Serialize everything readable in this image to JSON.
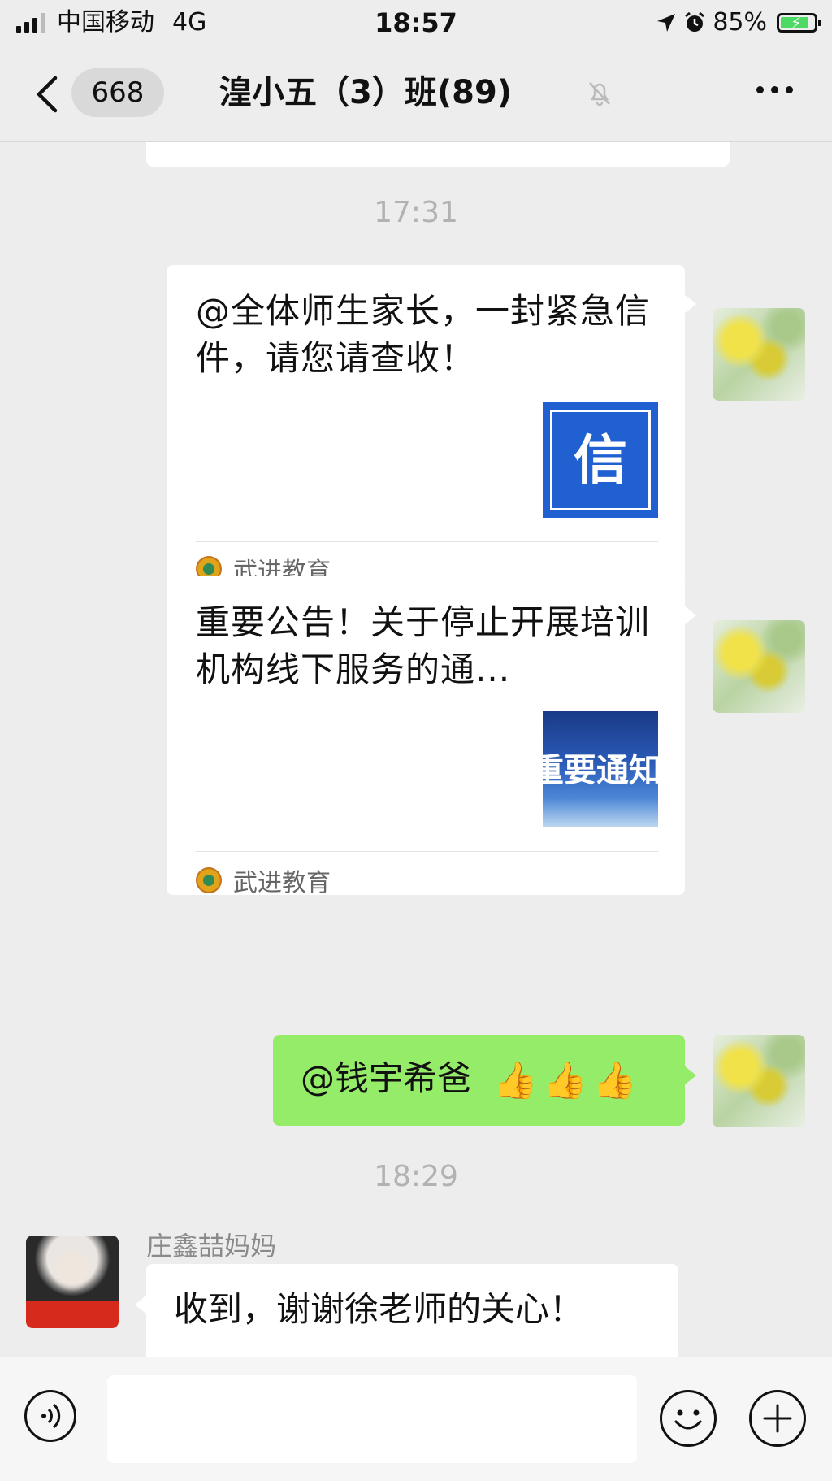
{
  "status_bar": {
    "carrier": "中国移动",
    "network": "4G",
    "time": "18:57",
    "battery_percent": "85%",
    "battery_level": 0.85,
    "icons": [
      "signal-icon",
      "location-arrow-icon",
      "alarm-clock-icon",
      "battery-charging-icon"
    ]
  },
  "nav": {
    "back_icon": "chevron-left-icon",
    "unread_count": "668",
    "title": "湟小五（3）班(89)",
    "mute_icon": "bell-muted-icon",
    "more_icon": "ellipsis-icon"
  },
  "chat": {
    "time_1": "17:31",
    "messages": [
      {
        "type": "article",
        "title": "@全体师生家长，一封紧急信件，请您请查收！",
        "thumb_text": "信",
        "source": "武进教育"
      },
      {
        "type": "article",
        "title": "重要公告！关于停止开展培训机构线下服务的通...",
        "thumb_text": "重要通知",
        "source": "武进教育"
      },
      {
        "type": "text",
        "text": "@钱宇希爸",
        "emoji": [
          "👍",
          "👍",
          "👍"
        ]
      }
    ],
    "time_2": "18:29",
    "incoming": {
      "sender": "庄鑫喆妈妈",
      "text": "收到，谢谢徐老师的关心！"
    }
  },
  "input_bar": {
    "voice_icon": "voice-icon",
    "emoji_icon": "smiley-icon",
    "plus_icon": "plus-icon"
  },
  "colors": {
    "background": "#ededed",
    "self_bubble": "#95ec69",
    "card": "#ffffff",
    "accent_thumb": "#2060d0"
  }
}
